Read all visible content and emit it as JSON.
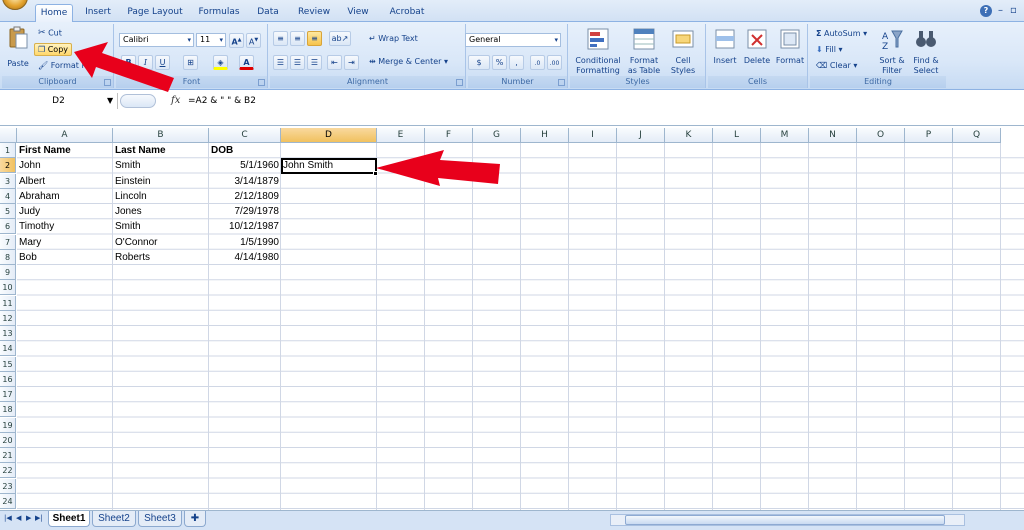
{
  "tabs": [
    "Home",
    "Insert",
    "Page Layout",
    "Formulas",
    "Data",
    "Review",
    "View",
    "Acrobat"
  ],
  "active_tab": "Home",
  "ribbon": {
    "clipboard": {
      "paste": "Paste",
      "cut": "Cut",
      "copy": "Copy",
      "format_painter": "Format Pai",
      "label": "Clipboard"
    },
    "font": {
      "font_name": "Calibri",
      "font_size": "11",
      "bold": "B",
      "italic": "I",
      "underline": "U",
      "label": "Font"
    },
    "alignment": {
      "wrap_text": "Wrap Text",
      "merge_center": "Merge & Center",
      "label": "Alignment"
    },
    "number": {
      "format": "General",
      "currency": "$",
      "percent": "%",
      "comma": ",",
      "label": "Number"
    },
    "styles": {
      "conditional": [
        "Conditional",
        "Formatting"
      ],
      "format_table": [
        "Format",
        "as Table"
      ],
      "cell_styles": [
        "Cell",
        "Styles"
      ],
      "label": "Styles"
    },
    "cells": {
      "insert": "Insert",
      "delete": "Delete",
      "format": "Format",
      "label": "Cells"
    },
    "editing": {
      "autosum": "AutoSum",
      "fill": "Fill",
      "clear": "Clear",
      "sort_filter": [
        "Sort &",
        "Filter"
      ],
      "find_select": [
        "Find &",
        "Select"
      ],
      "label": "Editing"
    }
  },
  "formula_bar": {
    "name_box": "D2",
    "fx": "fx",
    "formula": "=A2 & \" \" & B2"
  },
  "columns": [
    "A",
    "B",
    "C",
    "D",
    "E",
    "F",
    "G",
    "H",
    "I",
    "J",
    "K",
    "L",
    "M",
    "N",
    "O",
    "P",
    "Q"
  ],
  "rows": [
    "1",
    "2",
    "3",
    "4",
    "5",
    "6",
    "7",
    "8",
    "9",
    "10",
    "11",
    "12",
    "13",
    "14",
    "15",
    "16",
    "17",
    "18",
    "19",
    "20",
    "21",
    "22",
    "23",
    "24"
  ],
  "sheet": {
    "header": [
      "First Name",
      "Last Name",
      "DOB"
    ],
    "data": [
      [
        "John",
        "Smith",
        "5/1/1960",
        "John Smith"
      ],
      [
        "Albert",
        "Einstein",
        "3/14/1879",
        ""
      ],
      [
        "Abraham",
        "Lincoln",
        "2/12/1809",
        ""
      ],
      [
        "Judy",
        "Jones",
        "7/29/1978",
        ""
      ],
      [
        "Timothy",
        "Smith",
        "10/12/1987",
        ""
      ],
      [
        "Mary",
        "O'Connor",
        "1/5/1990",
        ""
      ],
      [
        "Bob",
        "Roberts",
        "4/14/1980",
        ""
      ]
    ]
  },
  "selected_cell": "D2",
  "sheet_tabs": [
    "Sheet1",
    "Sheet2",
    "Sheet3"
  ],
  "active_sheet": "Sheet1",
  "colors": {
    "ribbon_text": "#15428b",
    "selection_header": "#f1c15f",
    "annotation_arrow": "#e8001b"
  }
}
